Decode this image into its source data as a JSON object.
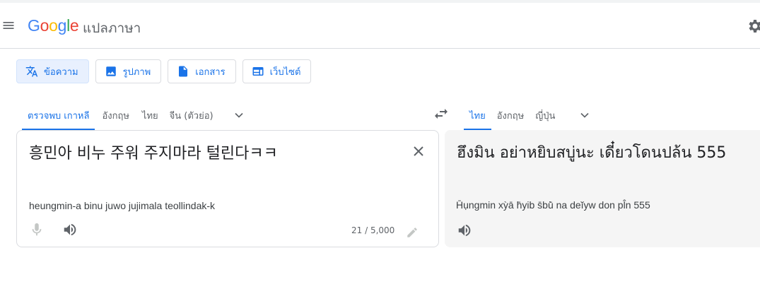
{
  "header": {
    "logo_letters": [
      {
        "ch": "G",
        "color": "#4285F4"
      },
      {
        "ch": "o",
        "color": "#EA4335"
      },
      {
        "ch": "o",
        "color": "#FBBC05"
      },
      {
        "ch": "g",
        "color": "#4285F4"
      },
      {
        "ch": "l",
        "color": "#34A853"
      },
      {
        "ch": "e",
        "color": "#EA4335"
      }
    ],
    "product": "แปลภาษา",
    "icons": {
      "menu": "menu-icon",
      "settings": "gear-icon"
    }
  },
  "modes": [
    {
      "label": "ข้อความ",
      "icon": "translate-icon",
      "active": true
    },
    {
      "label": "รูปภาพ",
      "icon": "image-icon",
      "active": false
    },
    {
      "label": "เอกสาร",
      "icon": "document-icon",
      "active": false
    },
    {
      "label": "เว็บไซต์",
      "icon": "website-icon",
      "active": false
    }
  ],
  "source_langs": [
    "ตรวจพบ เกาหลี",
    "อังกฤษ",
    "ไทย",
    "จีน (ตัวย่อ)"
  ],
  "target_langs": [
    "ไทย",
    "อังกฤษ",
    "ญี่ปุ่น"
  ],
  "source": {
    "text": "흥민아 비누 주워 주지마라 털린다ㅋㅋ",
    "transliteration": "heungmin-a binu juwo jujimala teollindak-k",
    "char_count": "21 / 5,000"
  },
  "target": {
    "text": "ฮึงมิน อย่าหยิบสบู่นะ เดี๋ยวโดนปล้น 555",
    "transliteration": "H̄ụngmin xỳā h̄yib s̄bū̀ na deĭyw don pl̂n 555"
  },
  "colors": {
    "accent": "#1a73e8",
    "active_mode_bg": "#e8f0fe",
    "target_bg": "#f5f5f5"
  }
}
